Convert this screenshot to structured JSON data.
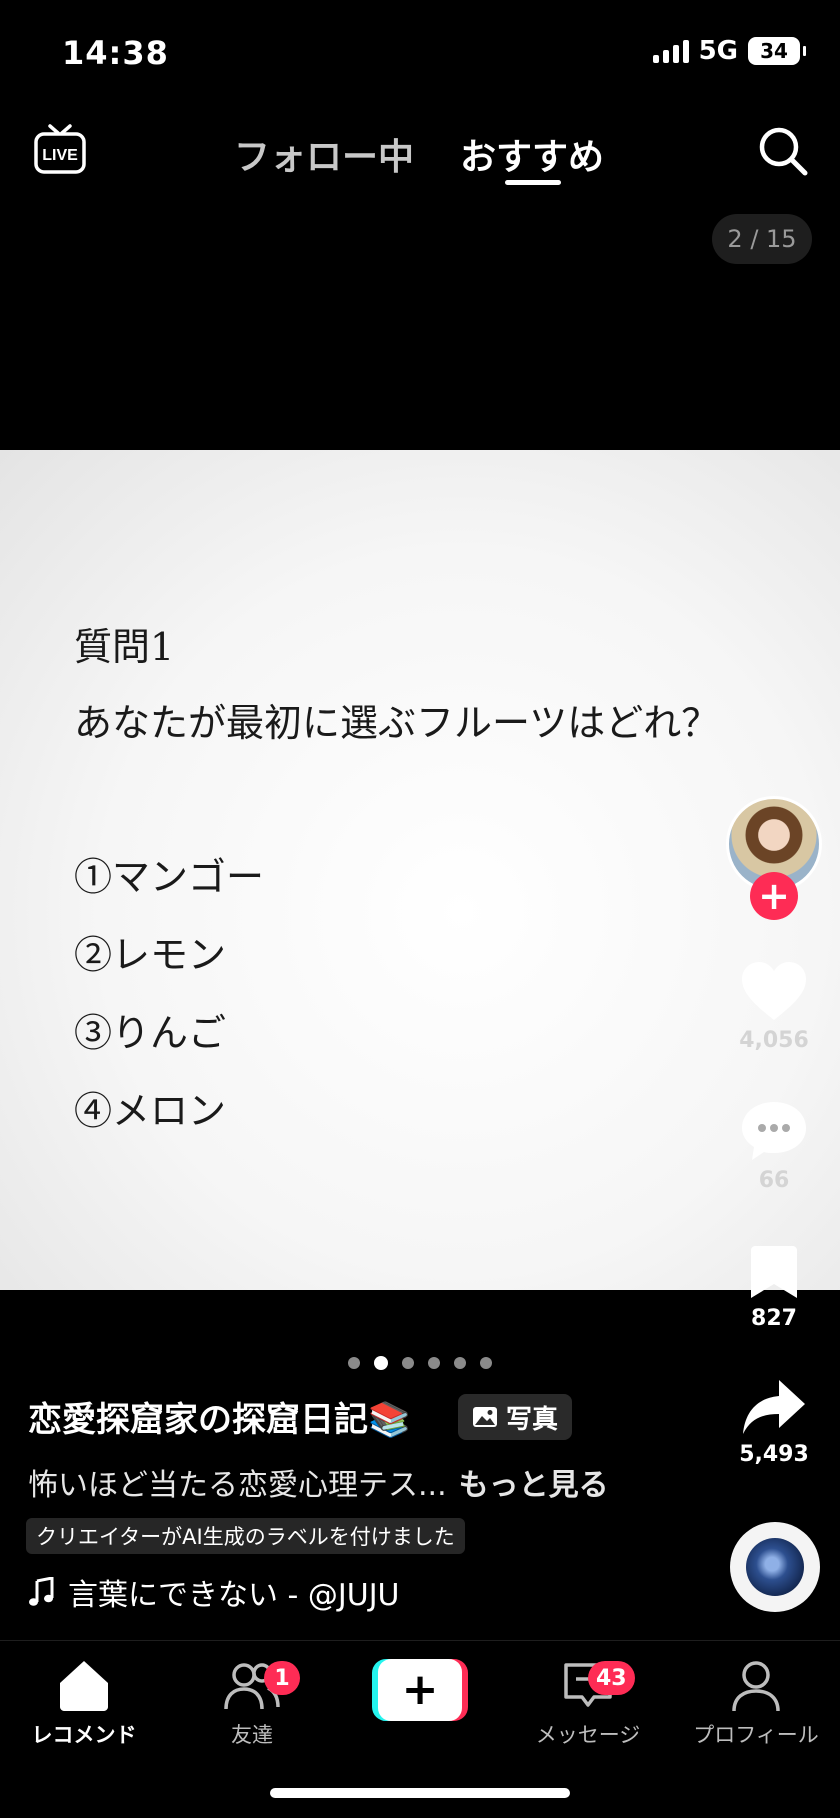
{
  "status_bar": {
    "time": "14:38",
    "network": "5G",
    "battery": "34"
  },
  "top_nav": {
    "live_label": "LIVE",
    "tabs": [
      {
        "label": "フォロー中"
      },
      {
        "label": "おすすめ"
      }
    ]
  },
  "page_counter": "2 / 15",
  "photo": {
    "question_label": "質問1",
    "question_text": "あなたが最初に選ぶフルーツはどれ？",
    "options": [
      "①マンゴー",
      "②レモン",
      "③りんご",
      "④メロン"
    ]
  },
  "actions": {
    "likes": "4,056",
    "comments": "66",
    "saves": "827",
    "shares": "5,493"
  },
  "carousel": {
    "total": 6,
    "active": 2
  },
  "post": {
    "creator_name": "恋愛探窟家の探窟日記📚",
    "photo_badge": "写真",
    "caption": "怖いほど当たる恋愛心理テス...",
    "more": "もっと見る",
    "ai_label": "クリエイターがAI生成のラベルを付けました",
    "music": "言葉にできない - @JUJU"
  },
  "bottom_nav": {
    "home": "レコメンド",
    "friends": "友達",
    "friends_badge": "1",
    "inbox": "メッセージ",
    "inbox_badge": "43",
    "profile": "プロフィール",
    "create_symbol": "+"
  },
  "colors": {
    "accent": "#fe2c55",
    "cyan": "#25f4ee",
    "background": "#000000"
  },
  "icons": [
    "live-icon",
    "search-icon",
    "heart-icon",
    "comment-icon",
    "bookmark-icon",
    "share-icon",
    "music-note-icon",
    "photo-icon",
    "home-icon",
    "friends-icon",
    "inbox-icon",
    "profile-icon"
  ]
}
